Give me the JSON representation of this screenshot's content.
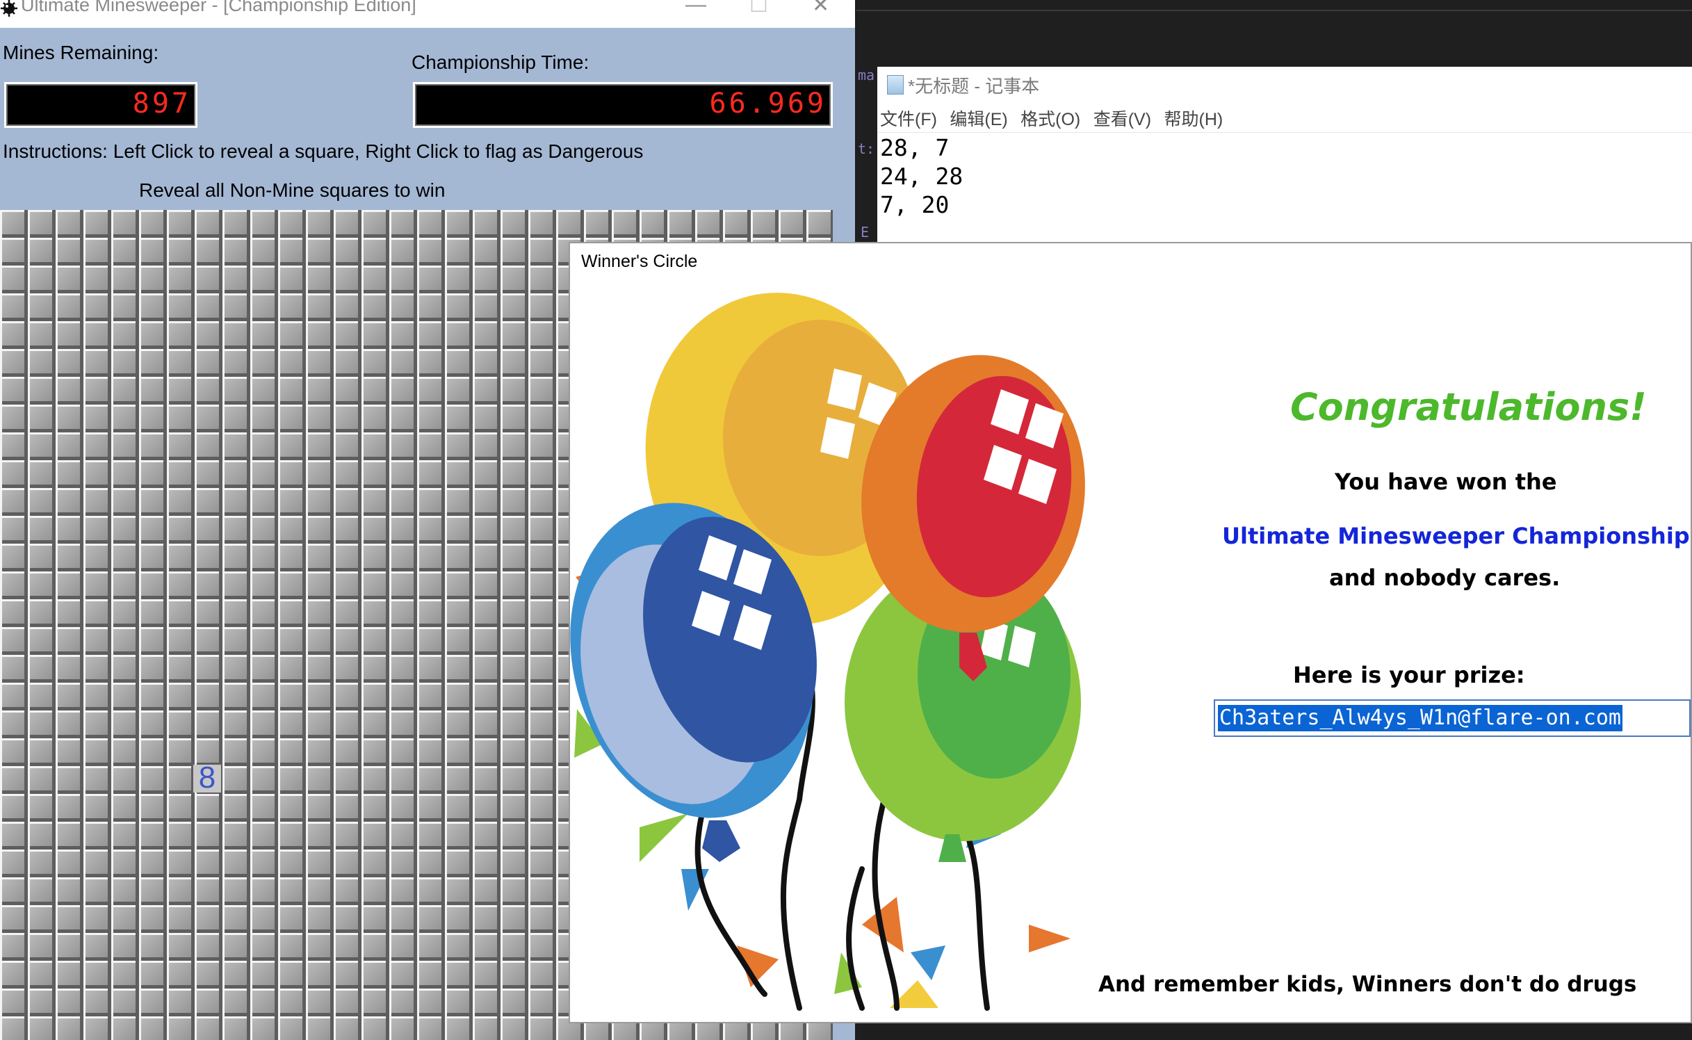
{
  "minesweeper": {
    "title": "Ultimate Minesweeper - [Championship Edition]",
    "window_controls": {
      "minimize": "—",
      "maximize": "☐",
      "close": "✕"
    },
    "mines_label": "Mines Remaining:",
    "mines_value": "897",
    "time_label": "Championship Time:",
    "time_value": "66.969",
    "instructions": "Instructions: Left Click to reveal a square, Right Click to flag as Dangerous",
    "goal": "Reveal all Non-Mine squares to win",
    "revealed_number": "8",
    "colors": {
      "window_bg": "#a4b8d4",
      "lcd_text": "#ff2a1f",
      "number_blue": "#3b56c9"
    }
  },
  "editor": {
    "gutter_fragments": [
      "ma",
      "t:",
      "E"
    ]
  },
  "notepad": {
    "title": "*无标题 - 记事本",
    "menu": [
      "文件(F)",
      "编辑(E)",
      "格式(O)",
      "查看(V)",
      "帮助(H)"
    ],
    "lines": [
      "28, 7",
      "24, 28",
      "7, 20"
    ]
  },
  "dialog": {
    "title": "Winner's Circle",
    "congrats": "Congratulations!",
    "line1": "You have won the",
    "line2": "Ultimate Minesweeper Championship",
    "line3": "and nobody cares.",
    "prize_label": "Here is your prize:",
    "prize_value": "Ch3aters_Alw4ys_W1n@flare-on.com",
    "footer": "And remember kids, Winners don't do drugs",
    "colors": {
      "congrats": "#4cb82c",
      "championship": "#1426d8",
      "selection": "#0a64d4"
    }
  }
}
